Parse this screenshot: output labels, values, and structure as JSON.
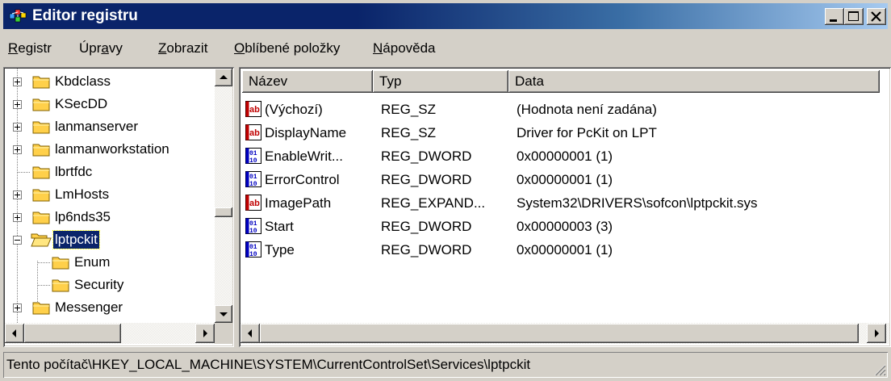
{
  "window": {
    "title": "Editor registru"
  },
  "menu": [
    {
      "pre": "",
      "key": "R",
      "post": "egistr"
    },
    {
      "pre": "Úpr",
      "key": "a",
      "post": "vy"
    },
    {
      "pre": "",
      "key": "Z",
      "post": "obrazit"
    },
    {
      "pre": "",
      "key": "O",
      "post": "blíbené položky"
    },
    {
      "pre": "",
      "key": "N",
      "post": "ápověda"
    }
  ],
  "tree": {
    "items": [
      {
        "label": "Kbdclass",
        "expander": "plus"
      },
      {
        "label": "KSecDD",
        "expander": "plus"
      },
      {
        "label": "lanmanserver",
        "expander": "plus"
      },
      {
        "label": "lanmanworkstation",
        "expander": "plus"
      },
      {
        "label": "lbrtfdc",
        "expander": "none"
      },
      {
        "label": "LmHosts",
        "expander": "plus"
      },
      {
        "label": "lp6nds35",
        "expander": "plus"
      },
      {
        "label": "lptpckit",
        "expander": "minus",
        "selected": true
      },
      {
        "label": "Enum",
        "child": true
      },
      {
        "label": "Security",
        "child": true
      },
      {
        "label": "Messenger",
        "expander": "plus"
      }
    ]
  },
  "list": {
    "columns": [
      "Název",
      "Typ",
      "Data"
    ],
    "rows": [
      {
        "icon": "string-value-icon",
        "name": "(Výchozí)",
        "type": "REG_SZ",
        "data": "(Hodnota není zadána)"
      },
      {
        "icon": "string-value-icon",
        "name": "DisplayName",
        "type": "REG_SZ",
        "data": "Driver for PcKit on LPT"
      },
      {
        "icon": "binary-value-icon",
        "name": "EnableWrit...",
        "type": "REG_DWORD",
        "data": "0x00000001 (1)"
      },
      {
        "icon": "binary-value-icon",
        "name": "ErrorControl",
        "type": "REG_DWORD",
        "data": "0x00000001 (1)"
      },
      {
        "icon": "string-value-icon",
        "name": "ImagePath",
        "type": "REG_EXPAND...",
        "data": "System32\\DRIVERS\\sofcon\\lptpckit.sys"
      },
      {
        "icon": "binary-value-icon",
        "name": "Start",
        "type": "REG_DWORD",
        "data": "0x00000003 (3)"
      },
      {
        "icon": "binary-value-icon",
        "name": "Type",
        "type": "REG_DWORD",
        "data": "0x00000001 (1)"
      }
    ]
  },
  "status": {
    "path": "Tento počítač\\HKEY_LOCAL_MACHINE\\SYSTEM\\CurrentControlSet\\Services\\lptpckit"
  },
  "colors": {
    "title_active": "#0a246a",
    "selection": "#0a246a",
    "face": "#d4d0c8",
    "folder": "#ffd04a"
  }
}
